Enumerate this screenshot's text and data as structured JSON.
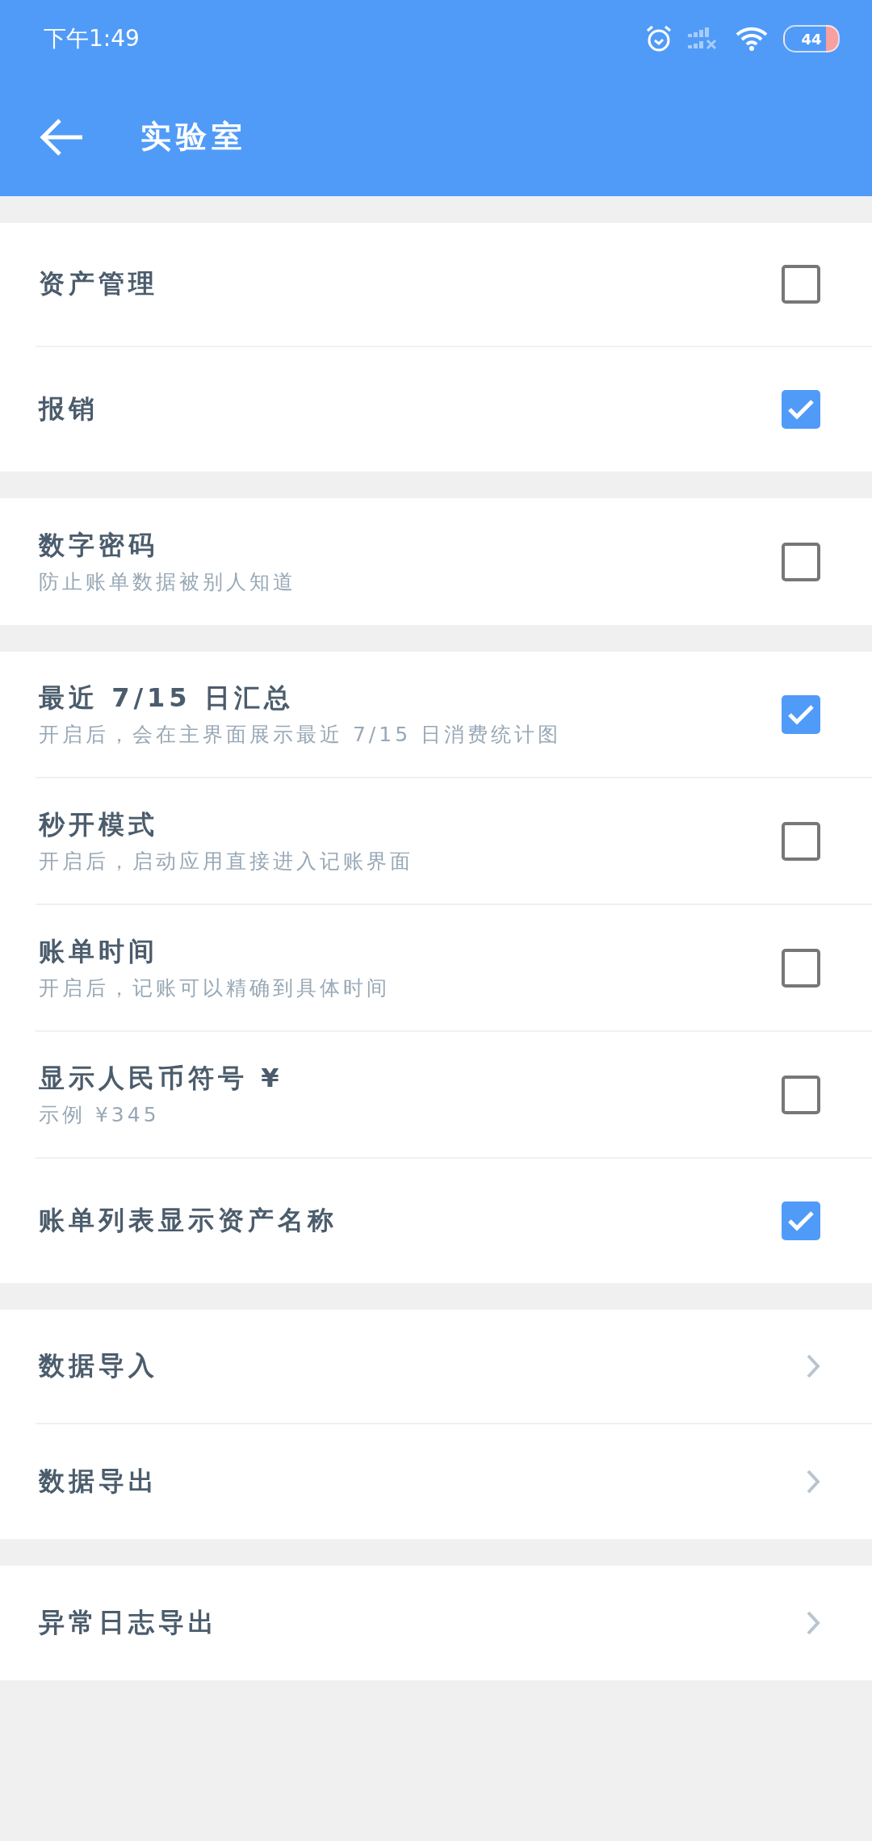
{
  "status_bar": {
    "time": "下午1:49",
    "battery": "44"
  },
  "header": {
    "title": "实验室"
  },
  "groups": [
    {
      "rows": [
        {
          "kind": "checkbox",
          "title": "资产管理",
          "checked": false
        },
        {
          "kind": "checkbox",
          "title": "报销",
          "checked": true
        }
      ]
    },
    {
      "rows": [
        {
          "kind": "checkbox",
          "title": "数字密码",
          "subtitle": "防止账单数据被别人知道",
          "checked": false
        }
      ]
    },
    {
      "rows": [
        {
          "kind": "checkbox",
          "title": "最近 7/15 日汇总",
          "subtitle": "开启后，会在主界面展示最近 7/15 日消费统计图",
          "checked": true
        },
        {
          "kind": "checkbox",
          "title": "秒开模式",
          "subtitle": "开启后，启动应用直接进入记账界面",
          "checked": false
        },
        {
          "kind": "checkbox",
          "title": "账单时间",
          "subtitle": "开启后，记账可以精确到具体时间",
          "checked": false
        },
        {
          "kind": "checkbox",
          "title": "显示人民币符号 ¥",
          "subtitle": "示例 ¥345",
          "checked": false
        },
        {
          "kind": "checkbox",
          "title": "账单列表显示资产名称",
          "checked": true
        }
      ]
    },
    {
      "rows": [
        {
          "kind": "link",
          "title": "数据导入"
        },
        {
          "kind": "link",
          "title": "数据导出"
        }
      ]
    },
    {
      "rows": [
        {
          "kind": "link",
          "title": "异常日志导出"
        }
      ]
    }
  ]
}
